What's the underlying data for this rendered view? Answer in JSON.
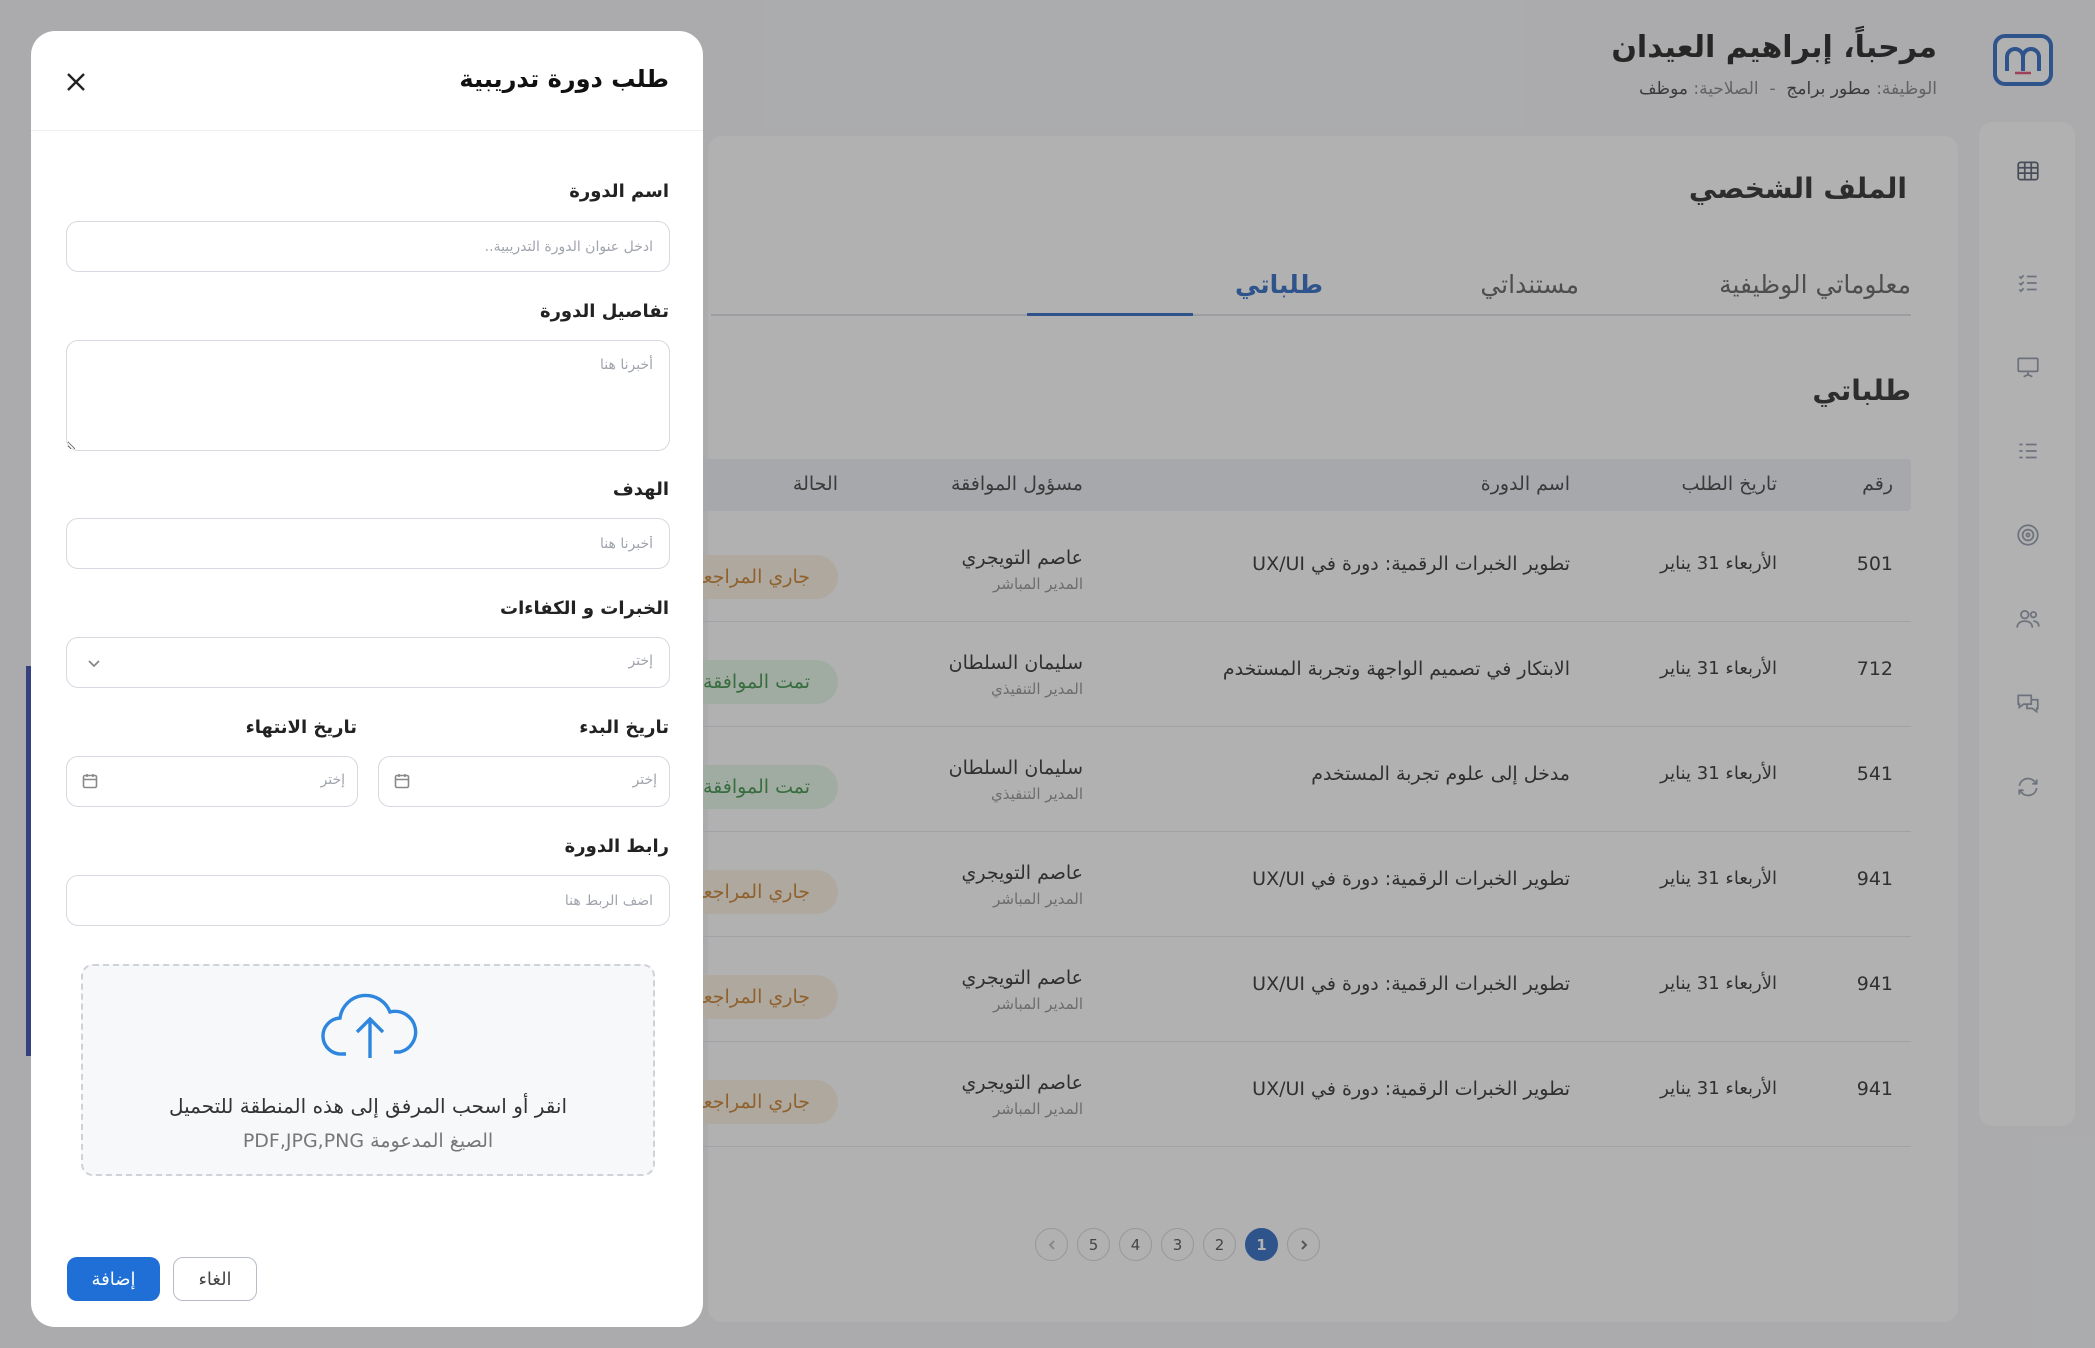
{
  "header": {
    "welcome": "مرحباً، إبراهيم العيدان",
    "job_label": "الوظيفة:",
    "job_value": "مطور برامج",
    "separator": "-",
    "role_label": "الصلاحية:",
    "role_value": "موظف"
  },
  "profile": {
    "title": "الملف الشخصي",
    "tabs": [
      {
        "label": "معلوماتي الوظيفية",
        "active": false
      },
      {
        "label": "مستنداتي",
        "active": false
      },
      {
        "label": "طلباتي",
        "active": true
      }
    ],
    "section_title": "طلباتي"
  },
  "table": {
    "columns": [
      "رقم",
      "تاريخ الطلب",
      "اسم الدورة",
      "مسؤول الموافقة",
      "الحالة"
    ],
    "rows": [
      {
        "id": "501",
        "date": "الأربعاء 31 يناير",
        "course": "تطوير الخبرات الرقمية: دورة في UX/UI",
        "approver": "عاصم التويجري",
        "approver_role": "المدير المباشر",
        "status": "جاري المراجعة",
        "status_type": "pending"
      },
      {
        "id": "712",
        "date": "الأربعاء 31 يناير",
        "course": "الابتكار في تصميم الواجهة وتجربة المستخدم",
        "approver": "سليمان السلطان",
        "approver_role": "المدير التنفيذي",
        "status": "تمت الموافقة",
        "status_type": "approved"
      },
      {
        "id": "541",
        "date": "الأربعاء 31 يناير",
        "course": "مدخل إلى علوم تجربة المستخدم",
        "approver": "سليمان السلطان",
        "approver_role": "المدير التنفيذي",
        "status": "تمت الموافقة",
        "status_type": "approved"
      },
      {
        "id": "941",
        "date": "الأربعاء 31 يناير",
        "course": "تطوير الخبرات الرقمية: دورة في UX/UI",
        "approver": "عاصم التويجري",
        "approver_role": "المدير المباشر",
        "status": "جاري المراجعة",
        "status_type": "pending"
      },
      {
        "id": "941",
        "date": "الأربعاء 31 يناير",
        "course": "تطوير الخبرات الرقمية: دورة في UX/UI",
        "approver": "عاصم التويجري",
        "approver_role": "المدير المباشر",
        "status": "جاري المراجعة",
        "status_type": "pending"
      },
      {
        "id": "941",
        "date": "الأربعاء 31 يناير",
        "course": "تطوير الخبرات الرقمية: دورة في UX/UI",
        "approver": "عاصم التويجري",
        "approver_role": "المدير المباشر",
        "status": "جاري المراجعة",
        "status_type": "pending"
      }
    ]
  },
  "pagination": {
    "pages": [
      "1",
      "2",
      "3",
      "4",
      "5"
    ],
    "current": "1"
  },
  "sidebar_icons": [
    "dashboard-icon",
    "checklist-icon",
    "presentation-icon",
    "list-icon",
    "target-icon",
    "users-icon",
    "chat-icon",
    "refresh-icon"
  ],
  "drawer": {
    "title": "طلب دورة تدريبية",
    "fields": {
      "course_name": {
        "label": "اسم الدورة",
        "placeholder": "ادخل عنوان الدورة التدريبية..",
        "value": ""
      },
      "course_details": {
        "label": "تفاصيل الدورة",
        "placeholder": "أخبرنا هنا",
        "value": ""
      },
      "goal": {
        "label": "الهدف",
        "placeholder": "أخبرنا هنا",
        "value": ""
      },
      "skills": {
        "label": "الخبرات و الكفاءات",
        "placeholder": "إختر"
      },
      "start_date": {
        "label": "تاريخ البدء",
        "placeholder": "إختر"
      },
      "end_date": {
        "label": "تاريخ الانتهاء",
        "placeholder": "إختر"
      },
      "course_link": {
        "label": "رابط الدورة",
        "placeholder": "اضف الربط هنا",
        "value": ""
      }
    },
    "upload": {
      "text": "انقر أو اسحب المرفق إلى هذه المنطقة للتحميل",
      "formats": "الصيغ المدعومة PDF,JPG,PNG"
    },
    "buttons": {
      "submit": "إضافة",
      "cancel": "الغاء"
    }
  },
  "colors": {
    "primary": "#1f6fd6",
    "pending_bg": "#fbefe0",
    "pending_text": "#c4761c",
    "approved_bg": "#e2f4e6",
    "approved_text": "#2f8a3c"
  }
}
